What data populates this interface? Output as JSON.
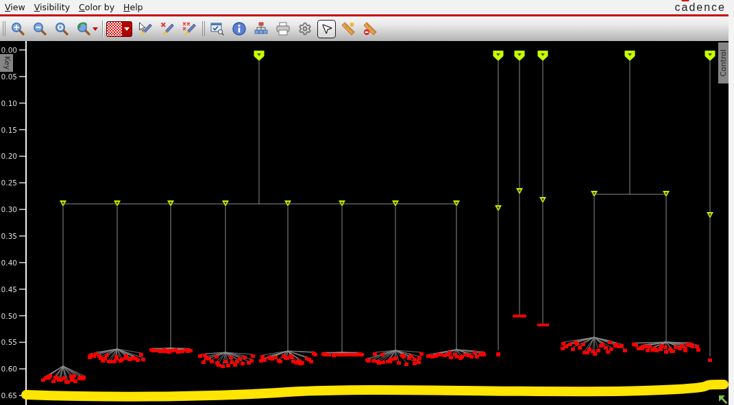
{
  "menu": [
    {
      "label": "View"
    },
    {
      "label": "Visibility"
    },
    {
      "label": "Color by"
    },
    {
      "label": "Help"
    }
  ],
  "logo": "cadence",
  "toolbars": [
    {
      "groups": [
        [
          {
            "kind": "zoom_in",
            "selected": false
          },
          {
            "kind": "zoom_out",
            "selected": false
          },
          {
            "kind": "zoom_fit",
            "selected": false
          },
          {
            "kind": "zoom_undo",
            "selected": false
          }
        ],
        [
          {
            "kind": "color",
            "selected": false
          },
          {
            "kind": "pen_select",
            "selected": false
          },
          {
            "kind": "pen_delete",
            "selected": false
          },
          {
            "kind": "pen_delete_all",
            "selected": false
          }
        ]
      ]
    },
    {
      "groups": [
        [
          {
            "kind": "window",
            "selected": false
          },
          {
            "kind": "info",
            "selected": false
          },
          {
            "kind": "hierarchy",
            "selected": false
          },
          {
            "kind": "print",
            "selected": false
          },
          {
            "kind": "settings",
            "selected": false
          },
          {
            "kind": "pointer",
            "selected": true
          },
          {
            "kind": "ruler_add",
            "selected": false
          },
          {
            "kind": "ruler_remove",
            "selected": false
          }
        ]
      ]
    }
  ],
  "plot": {
    "key_tab": {
      "label": "Key"
    },
    "control_tab": {
      "label": "Control"
    },
    "y_ticks": [
      "0.00",
      "0.05",
      "0.10",
      "0.15",
      "0.20",
      "0.25",
      "0.30",
      "0.35",
      "0.40",
      "0.45",
      "0.50",
      "0.55",
      "0.60",
      "0.65"
    ]
  }
}
